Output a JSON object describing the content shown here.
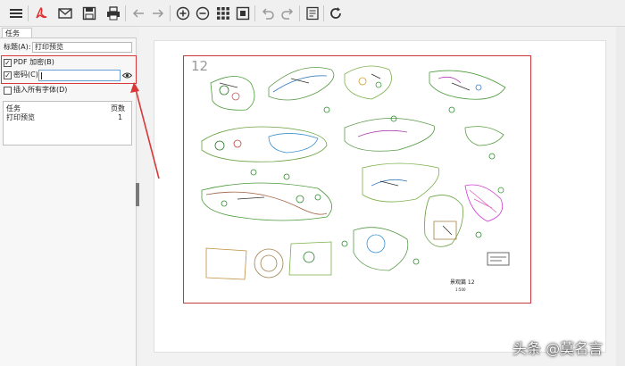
{
  "tab": {
    "label": "任务"
  },
  "form": {
    "title_label": "标题(A):",
    "title_value": "打印预览",
    "pdf_encrypt_label": "PDF 加密(B)",
    "password_label": "密码(C)",
    "password_value": "",
    "embed_fonts_label": "插入所有字体(D)"
  },
  "tasks": {
    "col_task": "任务",
    "col_pages": "页数",
    "rows": [
      {
        "task": "打印预览",
        "pages": "1"
      }
    ]
  },
  "preview": {
    "page_number": "12",
    "drawing_title": "景观篇 12",
    "drawing_sub": "1:500"
  },
  "watermark": "头条 @莫名言",
  "colors": {
    "highlight": "#d9383a",
    "accent_blue": "#6aa0d8"
  },
  "toolbar_icons": [
    "menu-icon",
    "pdf-icon",
    "mail-icon",
    "save-icon",
    "print-icon",
    "back-arrow-icon",
    "forward-arrow-icon",
    "zoom-in-icon",
    "zoom-out-icon",
    "grid-icon",
    "fit-page-icon",
    "undo-icon",
    "redo-icon",
    "document-icon",
    "refresh-icon"
  ]
}
